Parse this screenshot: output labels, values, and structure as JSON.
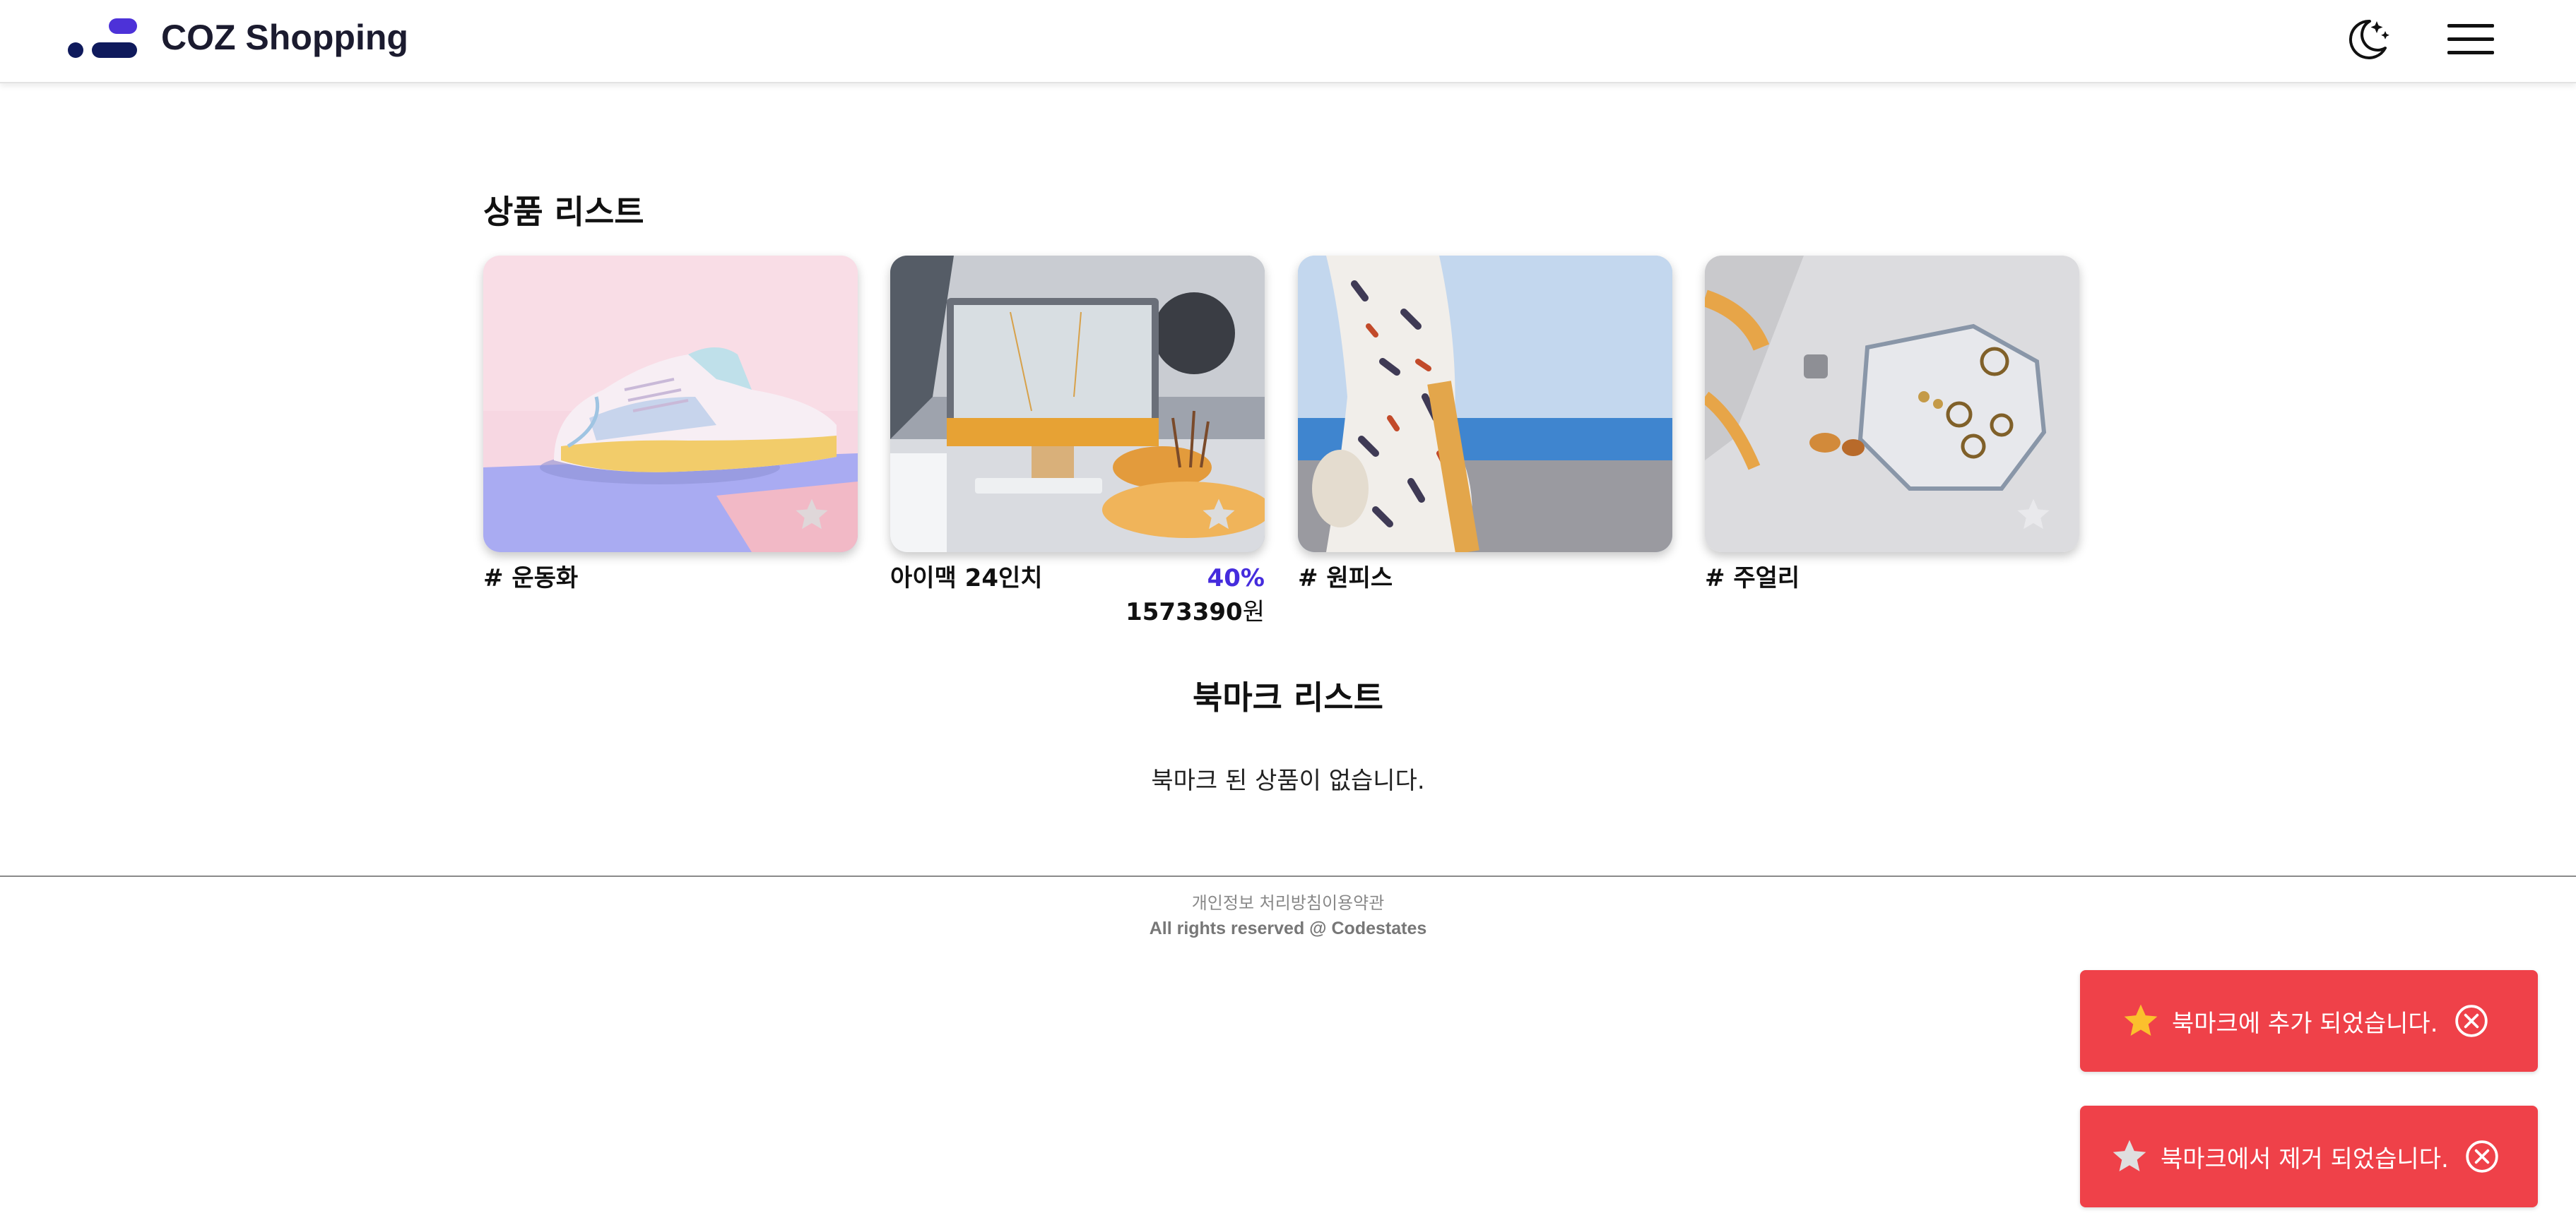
{
  "header": {
    "brand": "COZ Shopping",
    "logo_icon": "coz-logo-icon",
    "theme_icon": "moon-stars-icon",
    "menu_icon": "hamburger-menu-icon"
  },
  "products": {
    "title": "상품 리스트",
    "items": [
      {
        "label": "# 운동화",
        "kind": "category",
        "image": "pastel sneaker",
        "bookmarked": false
      },
      {
        "label": "아이맥 24인치",
        "kind": "product",
        "discount": "40%",
        "price": "1573390",
        "price_unit": "원",
        "image": "desktop computer on desk",
        "bookmarked": false
      },
      {
        "label": "# 원피스",
        "kind": "category",
        "image": "floral dress by the sea",
        "bookmarked": false
      },
      {
        "label": "# 주얼리",
        "kind": "category",
        "image": "rings on a plate",
        "bookmarked": false
      }
    ]
  },
  "bookmarks": {
    "title": "북마크 리스트",
    "empty_message": "북마크 된 상품이 없습니다."
  },
  "footer": {
    "links": "개인정보 처리방침이용약관",
    "copyright": "All rights reserved @ Codestates"
  },
  "toasts": [
    {
      "message": "북마크에 추가 되었습니다.",
      "icon": "star-filled-icon",
      "icon_color": "#fbc02d"
    },
    {
      "message": "북마크에서 제거 되었습니다.",
      "icon": "star-filled-icon",
      "icon_color": "#dfdfdf"
    }
  ],
  "colors": {
    "accent": "#452cdd",
    "toast_bg": "#ef4149",
    "logo_dark": "#0f1a5c",
    "logo_light": "#4d32d8"
  }
}
